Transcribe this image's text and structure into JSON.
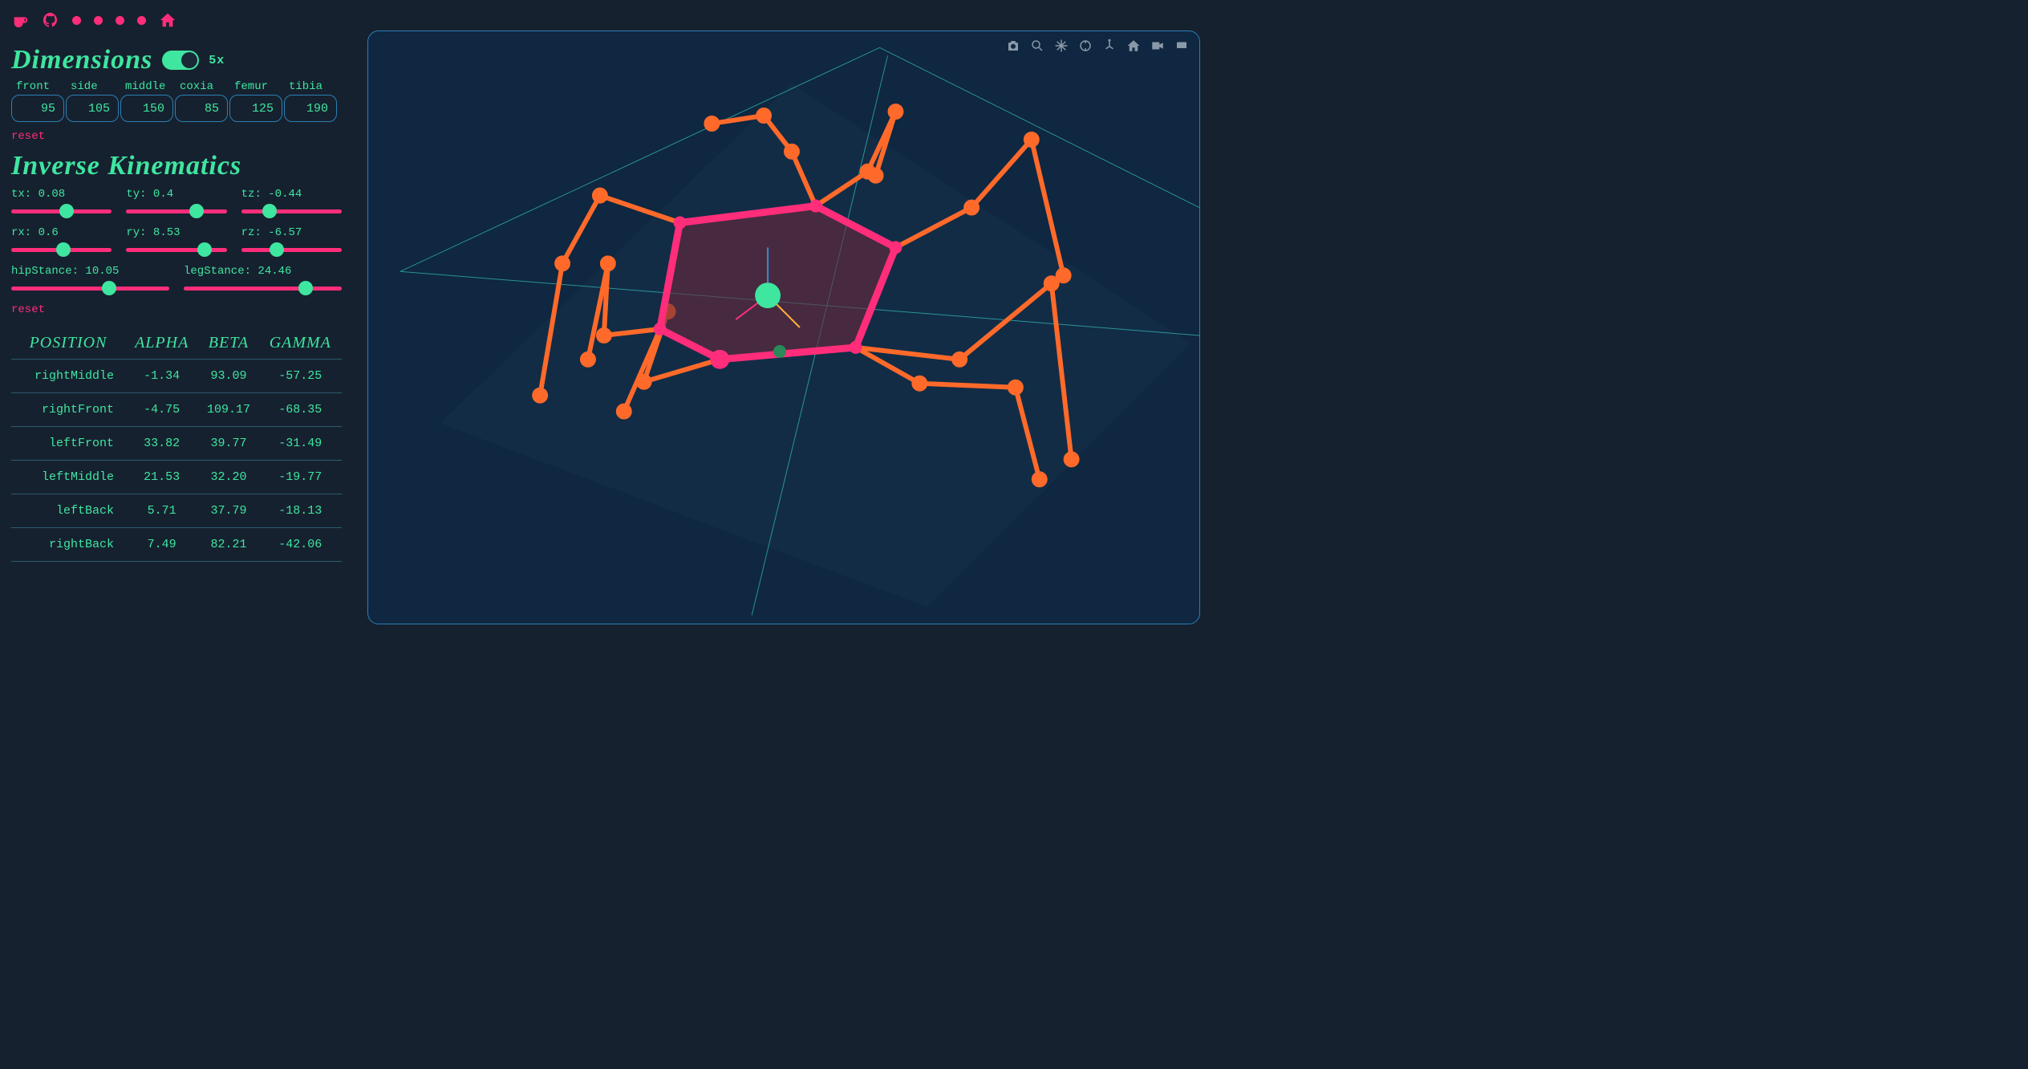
{
  "nav": {
    "items": [
      "kofi-icon",
      "github-icon",
      "dot",
      "dot",
      "dot",
      "dot",
      "home-icon"
    ]
  },
  "dimensions": {
    "title": "Dimensions",
    "toggle_label": "5x",
    "fields": [
      {
        "label": "front",
        "value": "95"
      },
      {
        "label": "side",
        "value": "105"
      },
      {
        "label": "middle",
        "value": "150"
      },
      {
        "label": "coxia",
        "value": "85"
      },
      {
        "label": "femur",
        "value": "125"
      },
      {
        "label": "tibia",
        "value": "190"
      }
    ],
    "reset": "reset"
  },
  "ik": {
    "title": "Inverse Kinematics",
    "sliders": [
      {
        "label": "tx: 0.08",
        "pos": 55
      },
      {
        "label": "ty: 0.4",
        "pos": 70
      },
      {
        "label": "tz: -0.44",
        "pos": 28
      },
      {
        "label": "rx: 0.6",
        "pos": 52
      },
      {
        "label": "ry: 8.53",
        "pos": 78
      },
      {
        "label": "rz: -6.57",
        "pos": 35
      }
    ],
    "sliders2": [
      {
        "label": "hipStance: 10.05",
        "pos": 62
      },
      {
        "label": "legStance: 24.46",
        "pos": 77
      }
    ],
    "reset": "reset"
  },
  "pose": {
    "headers": [
      "position",
      "alpha",
      "beta",
      "gamma"
    ],
    "rows": [
      {
        "position": "rightMiddle",
        "alpha": "-1.34",
        "beta": "93.09",
        "gamma": "-57.25"
      },
      {
        "position": "rightFront",
        "alpha": "-4.75",
        "beta": "109.17",
        "gamma": "-68.35"
      },
      {
        "position": "leftFront",
        "alpha": "33.82",
        "beta": "39.77",
        "gamma": "-31.49"
      },
      {
        "position": "leftMiddle",
        "alpha": "21.53",
        "beta": "32.20",
        "gamma": "-19.77"
      },
      {
        "position": "leftBack",
        "alpha": "5.71",
        "beta": "37.79",
        "gamma": "-18.13"
      },
      {
        "position": "rightBack",
        "alpha": "7.49",
        "beta": "82.21",
        "gamma": "-42.06"
      }
    ]
  },
  "plot_tools": [
    "camera-icon",
    "zoom-icon",
    "pan-icon",
    "orbit-icon",
    "reset-axis-icon",
    "home-icon",
    "video-icon",
    "save-icon"
  ],
  "colors": {
    "accent_pink": "#ff2d7a",
    "accent_green": "#3ee6a0",
    "body_orange": "#ff6a2a",
    "bg_dark": "#16212f",
    "canvas": "#0f2740",
    "border": "#2b7fb3"
  },
  "chart_data": {
    "type": "3d-skeleton",
    "description": "Hexapod robot wireframe: 6 legs (each coxia-femur-tibia chain) attached to hexagonal body, pink body outline, orange legs with joint dots, green center-of-gravity sphere, teal ground grid/plane.",
    "legs": [
      "rightMiddle",
      "rightFront",
      "leftFront",
      "leftMiddle",
      "leftBack",
      "rightBack"
    ]
  }
}
